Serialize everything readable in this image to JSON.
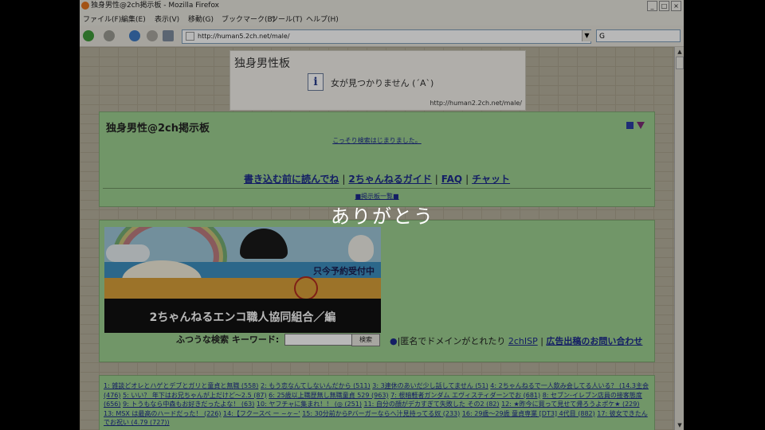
{
  "window": {
    "title": "独身男性@2ch掲示板 - Mozilla Firefox",
    "min": "_",
    "max": "□",
    "close": "×"
  },
  "menu": [
    "ファイル(F)",
    "編集(E)",
    "表示(V)",
    "移動(G)",
    "ブックマーク(B)",
    "ツール(T)",
    "ヘルプ(H)"
  ],
  "address": {
    "url": "http://human5.2ch.net/male/",
    "dropdown": "▼"
  },
  "search": {
    "placeholder": "G"
  },
  "scrollbar": {
    "up": "▲",
    "down": "▼"
  },
  "error": {
    "title": "独身男性板",
    "icon": "i",
    "message": "女が見つかりません (´A`)",
    "url": "http://human2.2ch.net/male/"
  },
  "header": {
    "title": "独身男性@2ch掲示板",
    "subtitle": "こっそり検索はじまりました。",
    "links": [
      "書き込む前に読んでね",
      "2ちゃんねるガイド",
      "FAQ",
      "チャット"
    ],
    "board_list": "■掲示板一覧■"
  },
  "ad": {
    "banner_band": "只今予約受付中",
    "banner_text": "2ちゃんねるエンコ職人協同組合／編",
    "search_label": "ふつうな検索 キーワード:",
    "search_button": "検索",
    "domain_text": "匿名でドメインがとれたり",
    "domain_link": "2chISP",
    "ad_contact": "広告出稿のお問い合わせ"
  },
  "threads": [
    "1: 雑談どオレとハゲとデブとガリと童貞と無職 (558)",
    "2: もう恋なんてしないんだから (511)",
    "3: 3連休のあいだ少し話してません (51)",
    "4: 2ちゃんねるで一人飲み会してる人いる？ (14.3主会 (476)",
    "5: いい？ 年下はお兄ちゃんが上だけど～2.5 (87)",
    "6: 25歳以上職歴無し無職童貞 529 (963)",
    "7: 根暗軽者ガンダム エヴィスティダーンでお (681)",
    "8: セブン-イレブン店員の接客態度 (656)",
    "9: トうもなら中森もお好きだったよな！ (63)",
    "10: ヤフチャに集まれ！！ (◎ (251)",
    "11: 自分の顔がデカすぎて失敗した その2 (82)",
    "12: ★昨今に買って見せて帰ろうよポケ★ (229)",
    "13: MSX は最高のハードだった！ (226)",
    "14:【フクースペ ー ~ヶ~'",
    "15: 30分前からPバーガーならへ汁見持ってる奴 (233)",
    "16: 29歳～29歳 童貞専業 [DT3] 4代目 (882)",
    "17: 彼女できたんでお祝い (4.79 (727))"
  ],
  "caption": "ありがとう"
}
